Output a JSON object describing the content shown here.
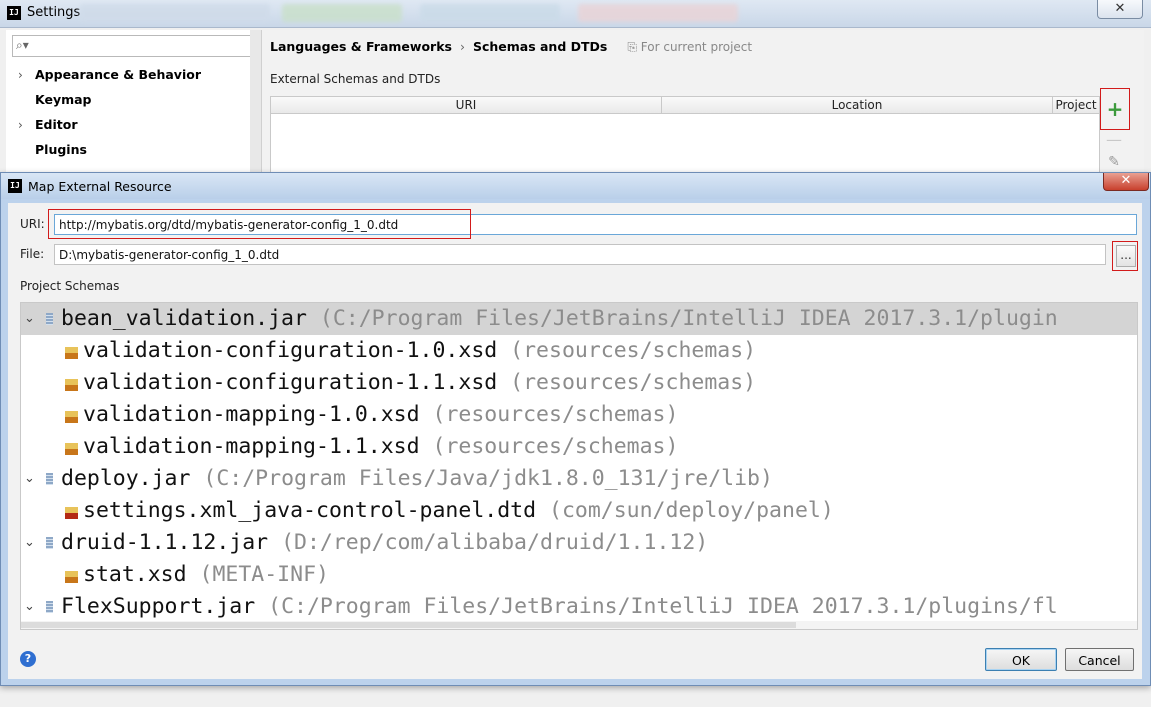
{
  "settings": {
    "title": "Settings",
    "logo_text": "IJ",
    "search": {
      "placeholder": ""
    },
    "sidebar": {
      "items": [
        {
          "label": "Appearance & Behavior",
          "expandable": true
        },
        {
          "label": "Keymap",
          "expandable": false
        },
        {
          "label": "Editor",
          "expandable": true
        },
        {
          "label": "Plugins",
          "expandable": false
        }
      ]
    },
    "breadcrumb": {
      "section": "Languages & Frameworks",
      "separator": "›",
      "page": "Schemas and DTDs",
      "scope": "For current project"
    },
    "external_schemas": {
      "label": "External Schemas and DTDs",
      "columns": [
        "URI",
        "Location",
        "Project"
      ]
    },
    "toolbar": {
      "add_icon": "plus-icon",
      "remove_icon": "minus-icon",
      "edit_icon": "pencil-icon"
    }
  },
  "dialog": {
    "title": "Map External Resource",
    "logo_text": "IJ",
    "uri_label": "URI:",
    "uri_value": "http://mybatis.org/dtd/mybatis-generator-config_1_0.dtd",
    "file_label": "File:",
    "file_value": "D:\\mybatis-generator-config_1_0.dtd",
    "browse_label": "...",
    "project_schemas_label": "Project Schemas",
    "tree": [
      {
        "name": "bean_validation.jar",
        "path": "(C:/Program Files/JetBrains/IntelliJ IDEA 2017.3.1/plugin",
        "level": 0,
        "type": "jar",
        "expanded": true,
        "selected": true
      },
      {
        "name": "validation-configuration-1.0.xsd",
        "path": "(resources/schemas)",
        "level": 1,
        "type": "xsd"
      },
      {
        "name": "validation-configuration-1.1.xsd",
        "path": "(resources/schemas)",
        "level": 1,
        "type": "xsd"
      },
      {
        "name": "validation-mapping-1.0.xsd",
        "path": "(resources/schemas)",
        "level": 1,
        "type": "xsd"
      },
      {
        "name": "validation-mapping-1.1.xsd",
        "path": "(resources/schemas)",
        "level": 1,
        "type": "xsd"
      },
      {
        "name": "deploy.jar",
        "path": "(C:/Program Files/Java/jdk1.8.0_131/jre/lib)",
        "level": 0,
        "type": "jar",
        "expanded": true
      },
      {
        "name": "settings.xml_java-control-panel.dtd",
        "path": "(com/sun/deploy/panel)",
        "level": 1,
        "type": "dtd"
      },
      {
        "name": "druid-1.1.12.jar",
        "path": "(D:/rep/com/alibaba/druid/1.1.12)",
        "level": 0,
        "type": "jar",
        "expanded": true
      },
      {
        "name": "stat.xsd",
        "path": "(META-INF)",
        "level": 1,
        "type": "xsd"
      },
      {
        "name": "FlexSupport.jar",
        "path": "(C:/Program Files/JetBrains/IntelliJ IDEA 2017.3.1/plugins/fl",
        "level": 0,
        "type": "jar",
        "expanded": true
      }
    ],
    "help_label": "?",
    "ok_label": "OK",
    "cancel_label": "Cancel"
  },
  "colors": {
    "highlight_red": "#d21b1b",
    "add_green": "#3c9a3c",
    "selected_row": "#d4d4d4",
    "path_gray": "#8c8c8c"
  }
}
